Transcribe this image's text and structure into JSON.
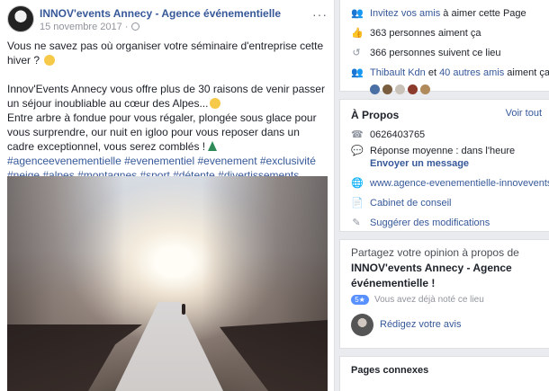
{
  "post": {
    "page_name": "INNOV'events Annecy - Agence événementielle",
    "date": "15 novembre 2017 ·",
    "more": "···",
    "text1": "Vous ne savez pas où organiser votre séminaire d'entreprise cette hiver ?",
    "text2": "Innov'Events Annecy vous offre plus de 30 raisons de venir passer un séjour inoubliable au cœur des Alpes...",
    "text3": "Entre arbre à fondue pour vous régaler, plongée sous glace pour vous surprendre, our nuit en igloo pour vous reposer dans un cadre exceptionnel, vous serez comblés !",
    "hashtags": "#agenceevenementielle #evenementiel #evenement #exclusivité #neige #alpes #montagnes #sport #détente #divertissements #sensations"
  },
  "community": {
    "invite_link": "Invitez vos amis",
    "invite_rest": " à aimer cette Page",
    "likes": "363 personnes aiment ça",
    "follows": "366 personnes suivent ce lieu",
    "friend_name": "Thibault Kdn",
    "friend_and": " et ",
    "friend_others": "40 autres amis",
    "friend_rest": " aiment ça",
    "face_colors": [
      "#4a6fa5",
      "#7a5c3e",
      "#c9c2b8",
      "#8b3a2b",
      "#b08a5a"
    ]
  },
  "about": {
    "title": "À Propos",
    "see_all": "Voir tout",
    "phone": "0626403765",
    "response": "Réponse moyenne : dans l'heure",
    "send_message": "Envoyer un message",
    "website": "www.agence-evenementielle-innovevents.fr",
    "category": "Cabinet de conseil",
    "suggest": "Suggérer des modifications"
  },
  "review_card": {
    "prompt_prefix": "Partagez votre opinion à propos de",
    "prompt_name": "INNOV'events Annecy - Agence événementielle",
    "prompt_suffix": " !",
    "rating_badge": "5★",
    "rating_text": "Vous avez déjà noté ce lieu",
    "write_review": "Rédigez votre avis"
  },
  "related": {
    "title": "Pages connexes"
  }
}
